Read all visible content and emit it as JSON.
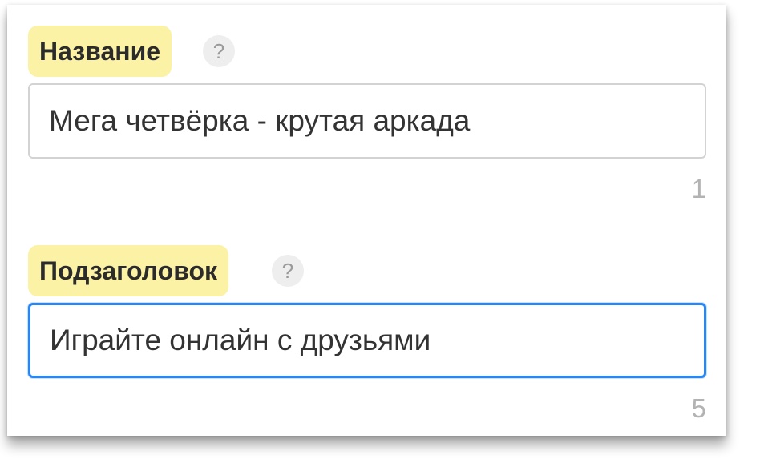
{
  "sections": [
    {
      "label": "Название",
      "help": "?",
      "value": "Мега четвёрка - крутая аркада",
      "counter": "1",
      "focused": false
    },
    {
      "label": "Подзаголовок",
      "help": "?",
      "value": "Играйте онлайн с друзьями",
      "counter": "5",
      "focused": true
    }
  ],
  "colors": {
    "label_highlight": "#fbf2a6",
    "focus_border": "#2a86f0",
    "default_border": "#d3d3d3",
    "counter_text": "#b3b3b3"
  }
}
